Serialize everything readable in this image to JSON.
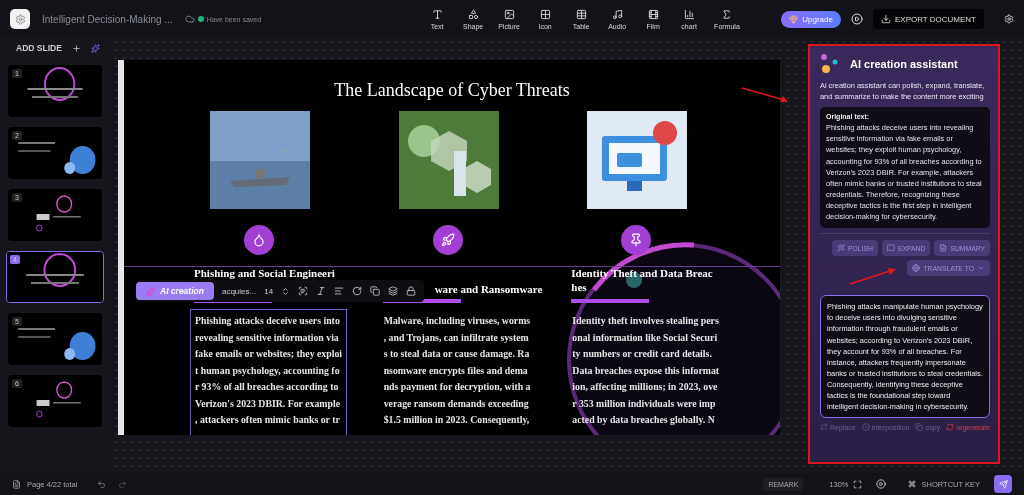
{
  "header": {
    "doc_title": "Intelligent Decision-Making ...",
    "save_status": "Have been saved",
    "tools": [
      {
        "label": "Text",
        "kind": "text"
      },
      {
        "label": "Shape",
        "kind": "shape"
      },
      {
        "label": "Picture",
        "kind": "picture"
      },
      {
        "label": "Icon",
        "kind": "icon"
      },
      {
        "label": "Table",
        "kind": "table"
      },
      {
        "label": "Audio",
        "kind": "audio"
      },
      {
        "label": "Film",
        "kind": "film"
      },
      {
        "label": "chart",
        "kind": "chart"
      },
      {
        "label": "Formula",
        "kind": "formula"
      }
    ],
    "upgrade": "Upgrade",
    "export": "EXPORT DOCUMENT"
  },
  "sidebar": {
    "add_slide": "ADD SLIDE",
    "slides": [
      {
        "number": "1",
        "selected": false
      },
      {
        "number": "2",
        "selected": false
      },
      {
        "number": "3",
        "selected": false
      },
      {
        "number": "4",
        "selected": true
      },
      {
        "number": "5",
        "selected": false
      },
      {
        "number": "6",
        "selected": false
      }
    ],
    "page_info": "Page 4/22 total"
  },
  "slide": {
    "title": "The Landscape of Cyber Threats",
    "columns": [
      {
        "heading": [
          "Phishing and Social Engineeri"
        ],
        "lines": [
          "Phishing attacks deceive users into",
          "revealing sensitive information via",
          "fake emails or websites; they exploi",
          "t human psychology, accounting fo",
          "r 93% of all breaches according to",
          "Verizon's 2023 DBIR. For example",
          ", attackers often mimic banks or tr"
        ],
        "selected": true
      },
      {
        "heading": [
          "ware and Ransomware"
        ],
        "lines": [
          "Malware, including viruses, worms",
          ", and Trojans, can infiltrate system",
          "s to steal data or cause damage. Ra",
          "nsomware encrypts files and dema",
          "nds payment for decryption, with a",
          "verage ransom demands exceeding",
          "$1.5 million in 2023. Consequently,"
        ],
        "selected": false
      },
      {
        "heading": [
          "Identity Theft and Data Breac",
          "hes"
        ],
        "lines": [
          "Identity theft involves stealing pers",
          "onal information like Social Securi",
          "ty numbers or credit card details.",
          "Data breaches expose this informat",
          "ion, affecting millions; in 2023, ove",
          "r 353 million individuals were imp",
          "acted by data breaches globally. N"
        ],
        "selected": false
      }
    ]
  },
  "text_toolbar": {
    "ai_button": "AI creation",
    "font": "acquies...",
    "size": "14"
  },
  "assistant": {
    "title": "AI creation assistant",
    "description": "Ai creation assistant can polish, expand, translate, and summarize to make the content more exciting",
    "original_label": "Original text:",
    "original_text": "Phishing attacks deceive users into revealing sensitive information via fake emails or websites; they exploit human psychology, accounting for 93% of all breaches according to Verizon's 2023 DBIR. For example, attackers often mimic banks or trusted institutions to steal credentials. Therefore, recognizing these deceptive tactics is the first step in intelligent decision-making for cybersecurity.",
    "actions": [
      {
        "label": "POLISH",
        "kind": "polish"
      },
      {
        "label": "EXPAND",
        "kind": "expand"
      },
      {
        "label": "SUMMARY",
        "kind": "summary"
      },
      {
        "label": "TRANSLATE TO",
        "kind": "translate"
      }
    ],
    "result_text": "Phishing attacks manipulate human psychology to deceive users into divulging sensitive information through fraudulent emails or websites; according to Verizon's 2023 DBIR, they account for 93% of all breaches. For instance, attackers frequently impersonate banks or trusted institutions to steal credentials. Consequently, identifying these deceptive tactics is the foundational step toward intelligent decision-making in cybersecurity.",
    "result_actions": [
      {
        "label": "Replace",
        "kind": "replace"
      },
      {
        "label": "interposition",
        "kind": "insert"
      },
      {
        "label": "copy",
        "kind": "copy"
      },
      {
        "label": "regenerate",
        "kind": "regenerate"
      }
    ]
  },
  "footer": {
    "remark": "REMARK",
    "zoom": "130%",
    "shortcut": "SHORTCUT KEY"
  }
}
